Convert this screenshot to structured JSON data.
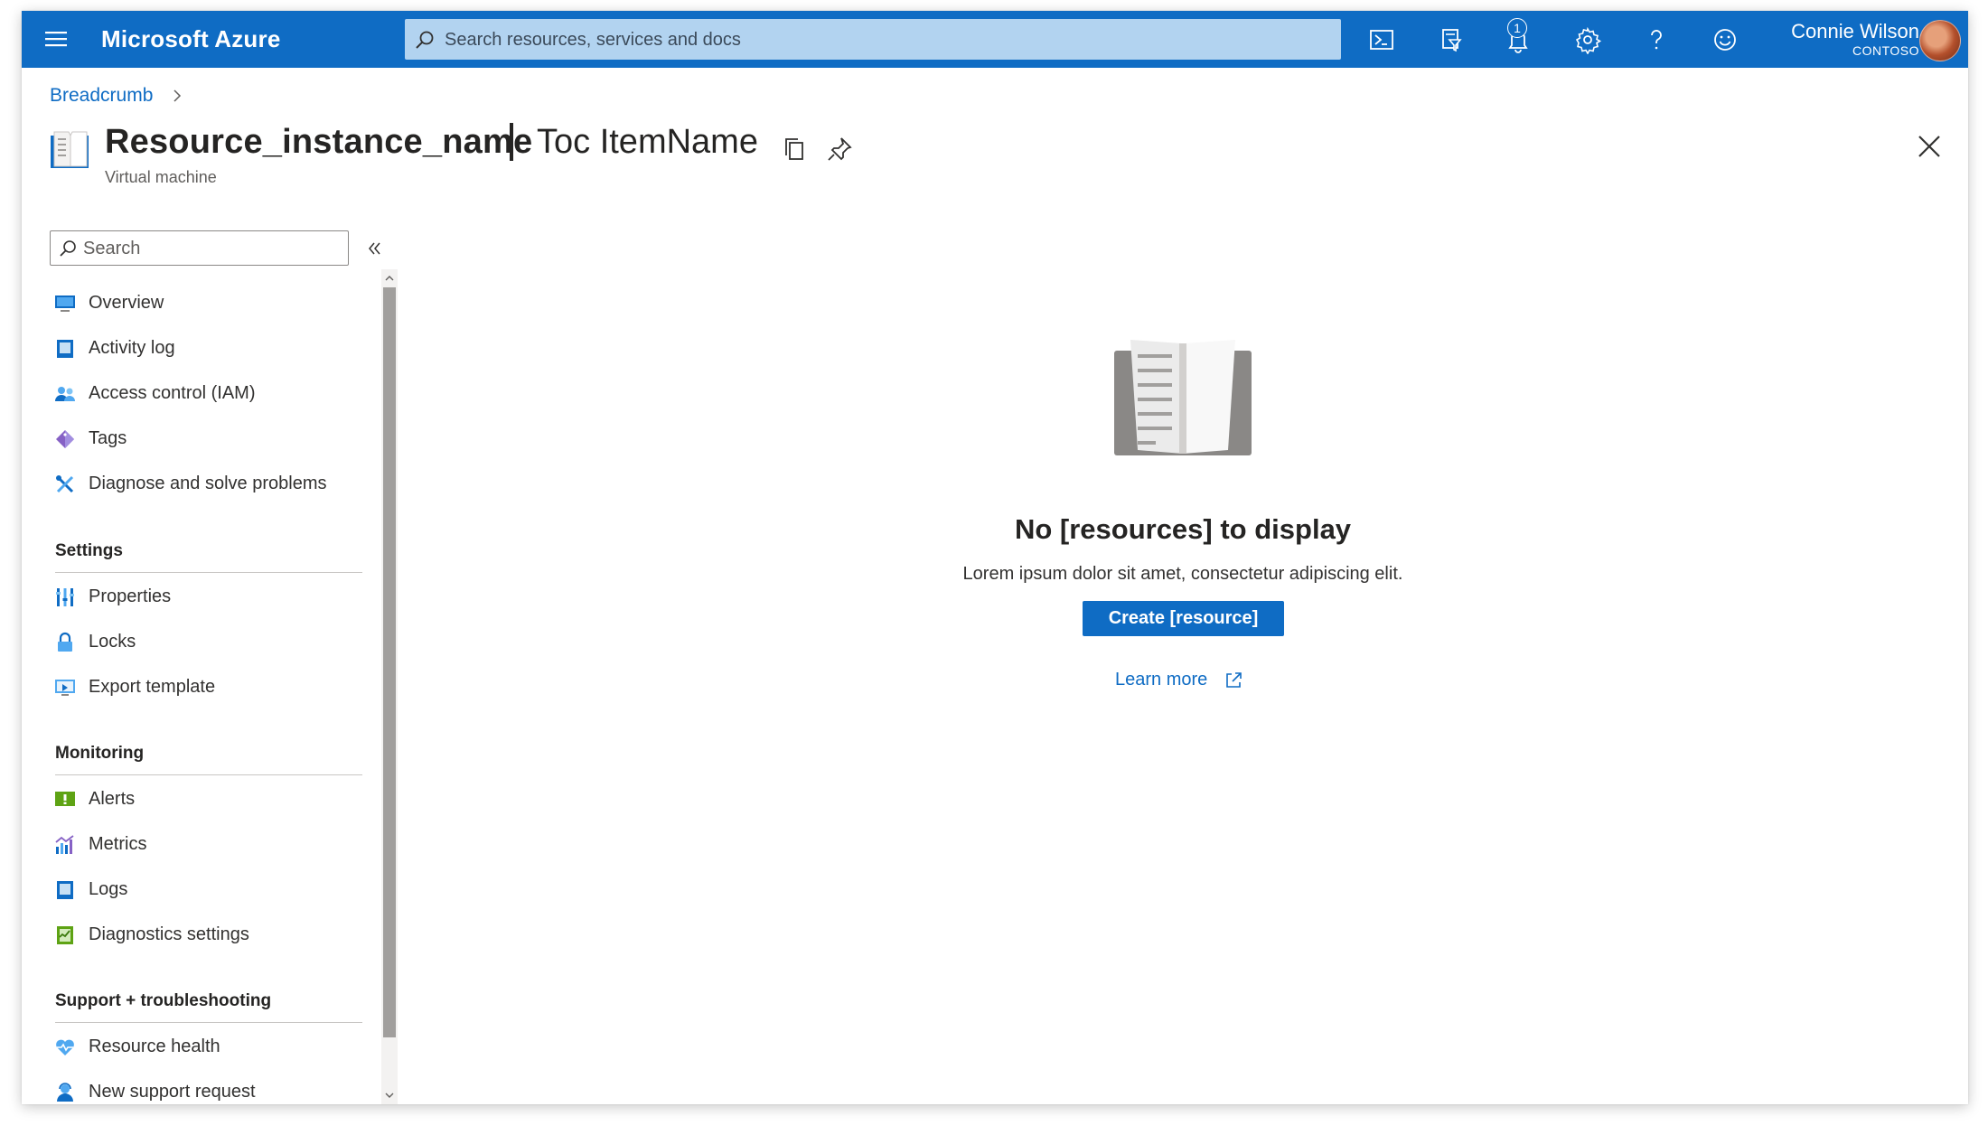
{
  "topbar": {
    "brand": "Microsoft Azure",
    "search_placeholder": "Search resources, services and docs",
    "notification_count": "1",
    "user_name": "Connie Wilson",
    "user_org": "CONTOSO",
    "icons": [
      "menu-icon",
      "cloud-shell-icon",
      "directory-filter-icon",
      "notifications-icon",
      "settings-icon",
      "help-icon",
      "feedback-icon"
    ]
  },
  "header": {
    "breadcrumb": "Breadcrumb",
    "resource_name": "Resource_instance_name",
    "toc_item": "Toc ItemName",
    "resource_type": "Virtual machine"
  },
  "nav": {
    "search_placeholder": "Search",
    "items": [
      {
        "label": "Overview",
        "icon": "overview-icon"
      },
      {
        "label": "Activity log",
        "icon": "activity-log-icon"
      },
      {
        "label": "Access control (IAM)",
        "icon": "access-control-icon"
      },
      {
        "label": "Tags",
        "icon": "tag-icon"
      },
      {
        "label": "Diagnose and solve problems",
        "icon": "diagnose-icon"
      }
    ],
    "sections": [
      {
        "title": "Settings",
        "items": [
          {
            "label": "Properties",
            "icon": "properties-icon"
          },
          {
            "label": "Locks",
            "icon": "lock-icon"
          },
          {
            "label": "Export template",
            "icon": "export-template-icon"
          }
        ]
      },
      {
        "title": "Monitoring",
        "items": [
          {
            "label": "Alerts",
            "icon": "alerts-icon"
          },
          {
            "label": "Metrics",
            "icon": "metrics-icon"
          },
          {
            "label": "Logs",
            "icon": "logs-icon"
          },
          {
            "label": "Diagnostics settings",
            "icon": "diagnostics-settings-icon"
          }
        ]
      },
      {
        "title": "Support + troubleshooting",
        "items": [
          {
            "label": "Resource health",
            "icon": "resource-health-icon"
          },
          {
            "label": "New support request",
            "icon": "support-request-icon"
          }
        ]
      }
    ]
  },
  "empty_state": {
    "title": "No [resources] to display",
    "description": "Lorem ipsum dolor sit amet, consectetur adipiscing elit.",
    "create_label": "Create [resource]",
    "learn_more_label": "Learn more"
  },
  "colors": {
    "accent": "#0f6cc4",
    "search_bg": "#b2d3f0",
    "scrollbar_thumb": "#a19f9d"
  }
}
